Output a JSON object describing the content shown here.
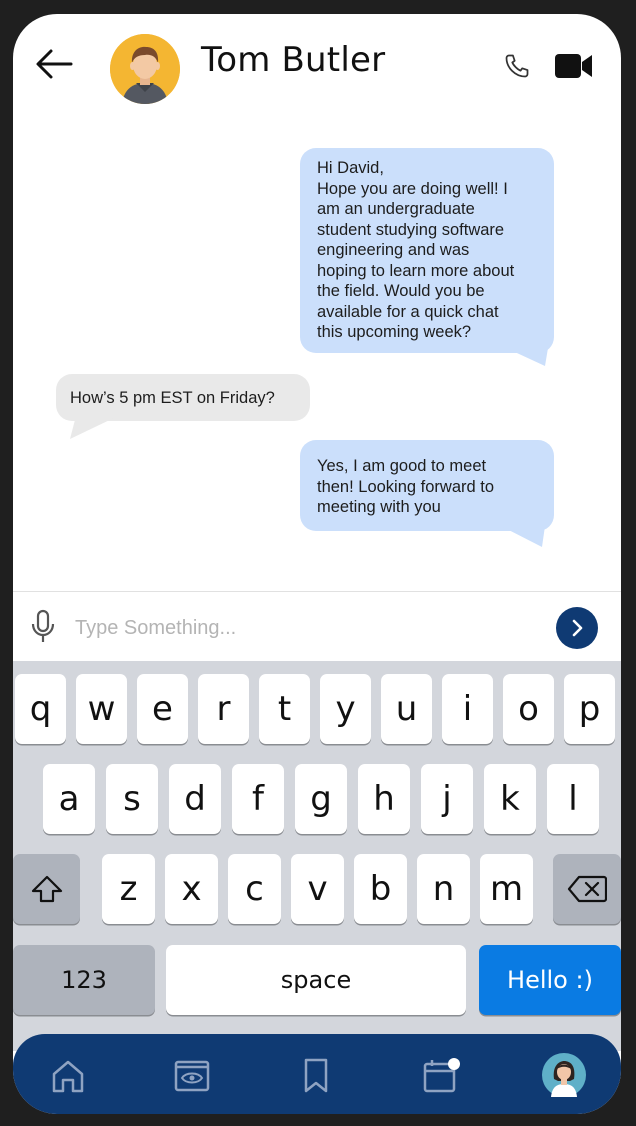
{
  "header": {
    "contact_name": "Tom Butler"
  },
  "messages": [
    {
      "direction": "outgoing",
      "lines": [
        "Hi David,",
        "Hope you are doing well! I",
        "am an undergraduate",
        "student studying software",
        "engineering and was",
        "hoping to learn more about",
        "the field. Would you be",
        "available for a quick chat",
        "this upcoming week?"
      ]
    },
    {
      "direction": "incoming",
      "lines": [
        "How’s 5 pm EST on Friday?"
      ]
    },
    {
      "direction": "outgoing",
      "lines": [
        "Yes, I am good to meet",
        "then! Looking forward to",
        "meeting with you"
      ]
    }
  ],
  "input": {
    "placeholder": "Type Something...",
    "value": ""
  },
  "keyboard": {
    "row1": [
      "q",
      "w",
      "e",
      "r",
      "t",
      "y",
      "u",
      "i",
      "o",
      "p"
    ],
    "row2": [
      "a",
      "s",
      "d",
      "f",
      "g",
      "h",
      "j",
      "k",
      "l"
    ],
    "row3": [
      "z",
      "x",
      "c",
      "v",
      "b",
      "n",
      "m"
    ],
    "numbers_label": "123",
    "space_label": "space",
    "suggestion_label": "Hello :)"
  },
  "nav": {
    "items": [
      "home-icon",
      "watch-icon",
      "bookmark-icon",
      "calendar-icon",
      "profile-avatar"
    ],
    "calendar_has_badge": true
  },
  "colors": {
    "outgoing_bubble": "#cbdffb",
    "incoming_bubble": "#e9e9e9",
    "brand_navy": "#0f3a73",
    "keyboard_action": "#0a7be3",
    "avatar_bg": "#f4b632"
  }
}
